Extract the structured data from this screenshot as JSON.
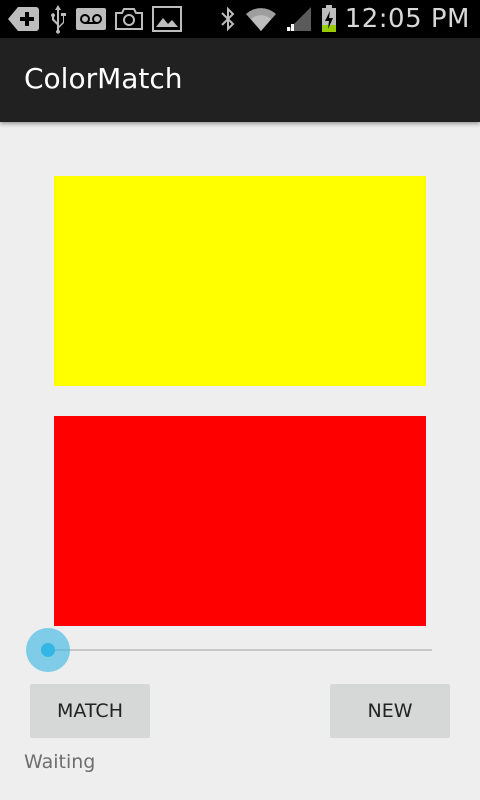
{
  "status_bar": {
    "time": "12:05 PM",
    "left_icons": [
      "add-icon",
      "usb-icon",
      "voicemail-icon",
      "camera-icon",
      "gallery-icon"
    ],
    "right_icons": [
      "bluetooth-icon",
      "wifi-icon",
      "signal-icon",
      "battery-charging-icon"
    ]
  },
  "action_bar": {
    "title": "ColorMatch"
  },
  "swatches": {
    "target_color": "#ffff00",
    "current_color": "#ff0000"
  },
  "slider": {
    "value": 0,
    "accent": "#33b5e5"
  },
  "buttons": {
    "match_label": "MATCH",
    "new_label": "NEW"
  },
  "status": {
    "text": "Waiting"
  }
}
